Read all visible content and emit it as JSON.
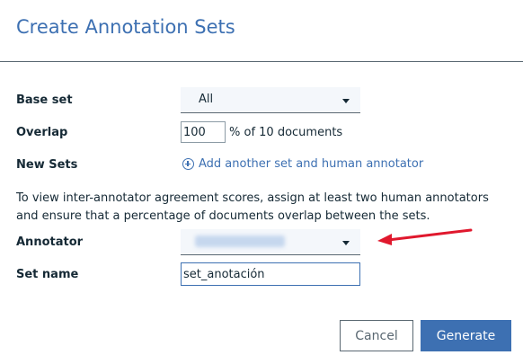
{
  "dialog": {
    "title": "Create Annotation Sets"
  },
  "form": {
    "base_set": {
      "label": "Base set",
      "value": "All"
    },
    "overlap": {
      "label": "Overlap",
      "value": "100",
      "suffix": "% of 10 documents"
    },
    "new_sets": {
      "label": "New Sets",
      "add_link": "Add another set and human annotator"
    },
    "info_text": "To view inter-annotator agreement scores, assign at least two human annotators and ensure that a percentage of documents overlap between the sets.",
    "annotator": {
      "label": "Annotator",
      "value_redacted": "redacted-name"
    },
    "set_name": {
      "label": "Set name",
      "value": "set_anotación"
    }
  },
  "buttons": {
    "cancel": "Cancel",
    "generate": "Generate"
  },
  "colors": {
    "accent": "#3d70b2",
    "arrow": "#e0182d",
    "text": "#152935"
  },
  "icons": {
    "add": "plus-circle-icon",
    "dropdown": "chevron-down-icon",
    "annotation_arrow": "red-arrow-icon"
  }
}
